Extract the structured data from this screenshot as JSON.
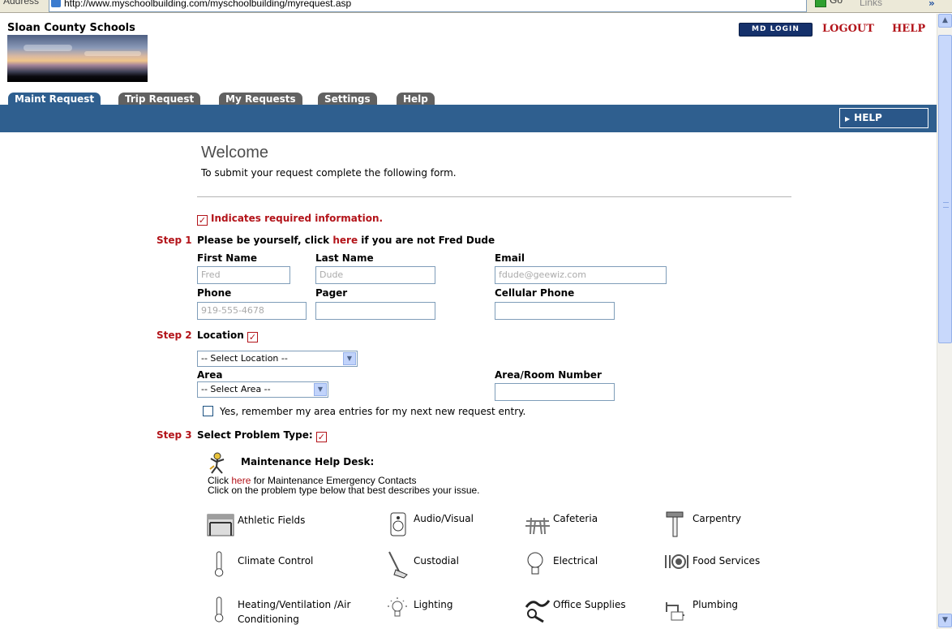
{
  "browser": {
    "address_label": "Address",
    "url": "http://www.myschoolbuilding.com/myschoolbuilding/myrequest.asp",
    "go_label": "Go",
    "links_label": "Links"
  },
  "header": {
    "org_name": "Sloan County Schools",
    "md_login_label": "MD LOGIN",
    "logout_label": "LOGOUT",
    "help_label": "HELP"
  },
  "tabs": [
    {
      "label": "Maint Request",
      "active": true
    },
    {
      "label": "Trip Request",
      "active": false
    },
    {
      "label": "My Requests",
      "active": false
    },
    {
      "label": "Settings",
      "active": false
    },
    {
      "label": "Help",
      "active": false
    }
  ],
  "help_button_label": "HELP",
  "welcome": {
    "title": "Welcome",
    "intro": "To submit your request complete the following form."
  },
  "required_note": "Indicates required information.",
  "step1": {
    "step_label": "Step 1",
    "text_before": "Please be yourself, click ",
    "link": "here",
    "text_after": " if you are not Fred Dude",
    "fields": {
      "first_name": {
        "label": "First Name",
        "value": "Fred"
      },
      "last_name": {
        "label": "Last Name",
        "value": "Dude"
      },
      "email": {
        "label": "Email",
        "value": "fdude@geewiz.com"
      },
      "phone": {
        "label": "Phone",
        "value": "919-555-4678"
      },
      "pager": {
        "label": "Pager",
        "value": ""
      },
      "cellular": {
        "label": "Cellular Phone",
        "value": ""
      }
    }
  },
  "step2": {
    "step_label": "Step 2",
    "title": "Location",
    "location_select": "-- Select Location --",
    "area_label": "Area",
    "area_select": "-- Select Area --",
    "room_label": "Area/Room Number",
    "room_value": "",
    "remember_label": "Yes, remember my area entries for my next new request entry."
  },
  "step3": {
    "step_label": "Step 3",
    "title": "Select Problem Type:",
    "helpdesk_title": "Maintenance Help Desk:",
    "click_text_before": "Click ",
    "click_link": "here",
    "click_text_after": " for Maintenance Emergency Contacts",
    "instruction": "Click on the problem type below that best describes your issue.",
    "problem_types": [
      {
        "label": "Athletic Fields",
        "icon": "athletic-field-icon"
      },
      {
        "label": "Audio/Visual",
        "icon": "speaker-icon"
      },
      {
        "label": "Cafeteria",
        "icon": "table-icon"
      },
      {
        "label": "Carpentry",
        "icon": "hammer-icon"
      },
      {
        "label": "Climate Control",
        "icon": "thermometer-icon"
      },
      {
        "label": "Custodial",
        "icon": "mop-icon"
      },
      {
        "label": "Electrical",
        "icon": "lightbulb-icon"
      },
      {
        "label": "Food Services",
        "icon": "plate-icon"
      },
      {
        "label": "Heating/Ventilation /Air Conditioning",
        "icon": "thermometer-icon"
      },
      {
        "label": "Lighting",
        "icon": "lit-bulb-icon"
      },
      {
        "label": "Office Supplies",
        "icon": "office-supplies-icon"
      },
      {
        "label": "Plumbing",
        "icon": "faucet-icon"
      }
    ]
  },
  "colors": {
    "accent_red": "#b3141a",
    "nav_blue": "#2f5f8f",
    "tab_gray": "#616161"
  }
}
